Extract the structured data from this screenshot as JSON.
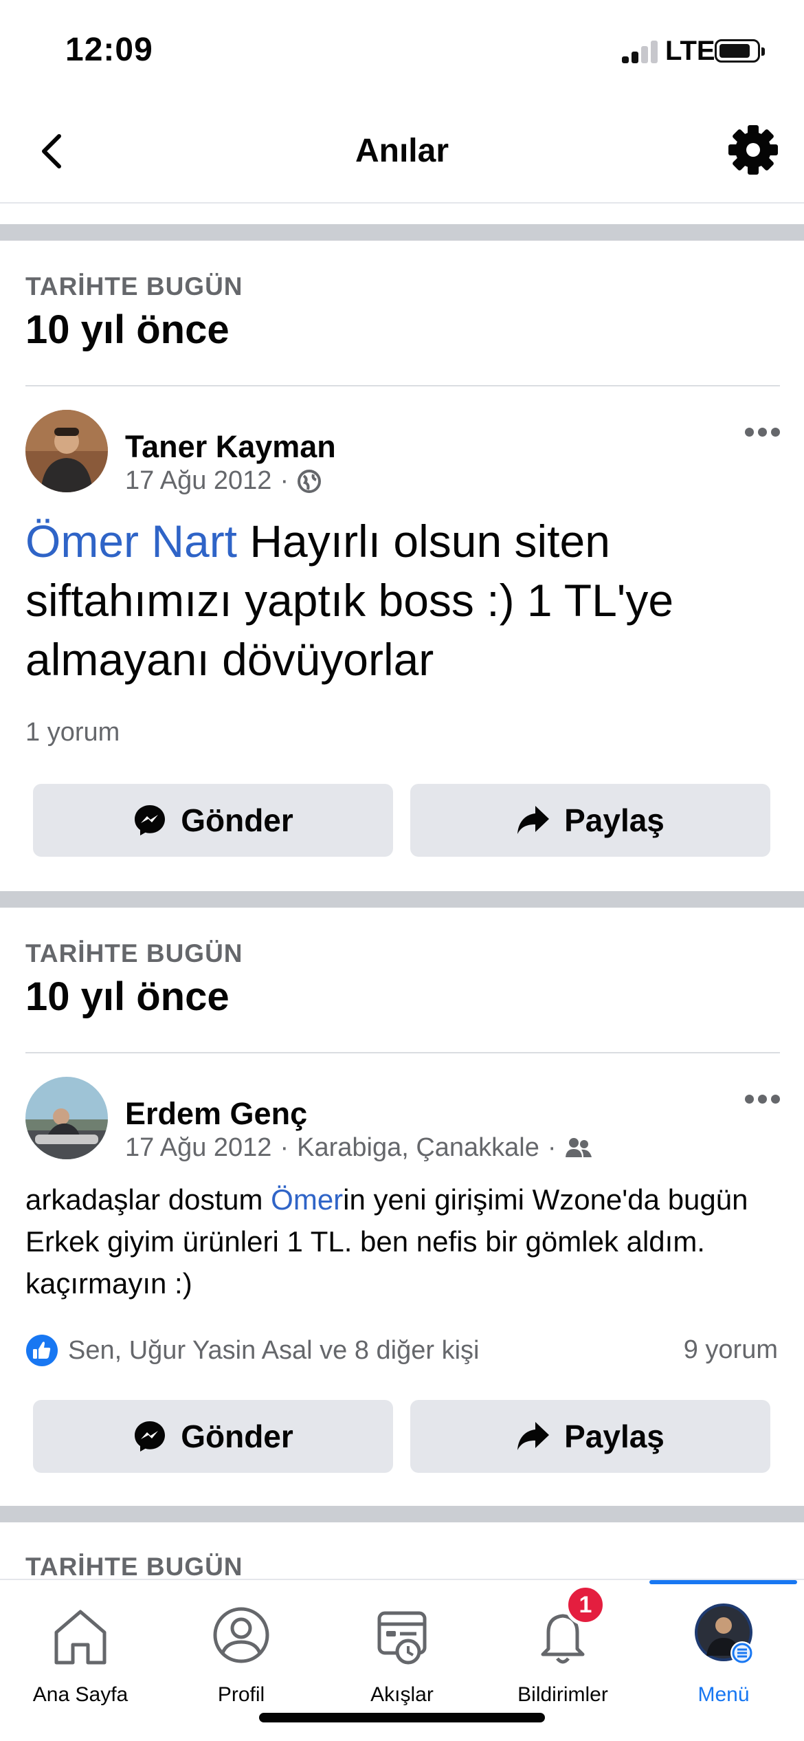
{
  "status_bar": {
    "time": "12:09",
    "network": "LTE"
  },
  "header": {
    "title": "Anılar"
  },
  "memories": [
    {
      "kicker": "TARİHTE BUGÜN",
      "ago": "10 yıl önce",
      "post": {
        "author": "Taner Kayman",
        "date": "17 Ağu 2012",
        "privacy_icon": "globe-icon",
        "mention": "Ömer Nart",
        "text": " Hayırlı olsun siten siftahımızı yaptık boss :) 1 TL'ye almayanı dövüyorlar",
        "comments": "1 yorum"
      },
      "actions": {
        "send": "Gönder",
        "share": "Paylaş"
      }
    },
    {
      "kicker": "TARİHTE BUGÜN",
      "ago": "10 yıl önce",
      "post": {
        "author": "Erdem Genç",
        "date": "17 Ağu 2012",
        "location": "Karabiga, Çanakkale",
        "privacy_icon": "friends-icon",
        "text_before": "arkadaşlar dostum ",
        "mention": "Ömer",
        "text_after": "in yeni girişimi Wzone'da bugün Erkek giyim ürünleri 1 TL. ben nefis bir gömlek aldım. kaçırmayın :)",
        "reactions": "Sen, Uğur Yasin Asal ve 8 diğer kişi",
        "comments": "9 yorum"
      },
      "actions": {
        "send": "Gönder",
        "share": "Paylaş"
      }
    },
    {
      "kicker": "TARİHTE BUGÜN"
    }
  ],
  "tabbar": {
    "items": [
      {
        "label": "Ana Sayfa",
        "icon": "home-icon"
      },
      {
        "label": "Profil",
        "icon": "profile-icon"
      },
      {
        "label": "Akışlar",
        "icon": "feeds-icon"
      },
      {
        "label": "Bildirimler",
        "icon": "bell-icon"
      },
      {
        "label": "Menü",
        "icon": "menu-avatar-icon"
      }
    ],
    "notification_count": "1",
    "active_color": "#1877f2"
  },
  "colors": {
    "link": "#2f64c7",
    "muted": "#65676b",
    "button_bg": "#e4e6eb",
    "badge": "#e41e3f"
  }
}
